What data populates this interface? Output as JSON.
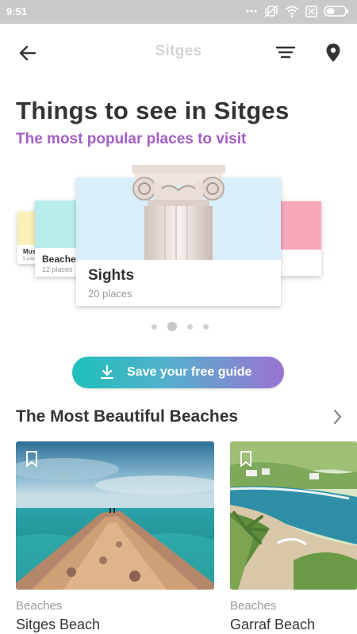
{
  "status_bar": {
    "time": "9:51",
    "icons": [
      "more-dots-icon",
      "vibrate-off-icon",
      "wifi-icon",
      "sim-off-icon",
      "battery-icon"
    ]
  },
  "app_bar": {
    "title": "Sitges",
    "icons": [
      "back-arrow-icon",
      "filter-icon",
      "map-pin-icon"
    ]
  },
  "header": {
    "title": "Things to see in Sitges",
    "subtitle": "The most popular places to visit",
    "subtitle_color": "#a35ec7"
  },
  "carousel": {
    "cards": [
      {
        "name": "Mus",
        "count": "5 places",
        "color": "#fbf0b8"
      },
      {
        "name": "Beache",
        "count": "12 places",
        "color": "#b7ece9"
      },
      {
        "name": "Sights",
        "count": "20 places",
        "color": "#d8effa",
        "image": "column-capital"
      },
      {
        "name": "",
        "count": "",
        "color": "#f8a9b9"
      }
    ],
    "active_index": 1,
    "dot_count": 4
  },
  "save_button": {
    "label": "Save your free guide",
    "icon": "download-icon",
    "gradient": [
      "#1fbfba",
      "#9b73d2"
    ]
  },
  "section": {
    "title": "The Most Beautiful Beaches",
    "icon": "chevron-right-icon",
    "items": [
      {
        "category": "Beaches",
        "name": "Sitges Beach",
        "icon": "bookmark-icon"
      },
      {
        "category": "Beaches",
        "name": "Garraf Beach",
        "icon": "bookmark-icon"
      }
    ]
  }
}
